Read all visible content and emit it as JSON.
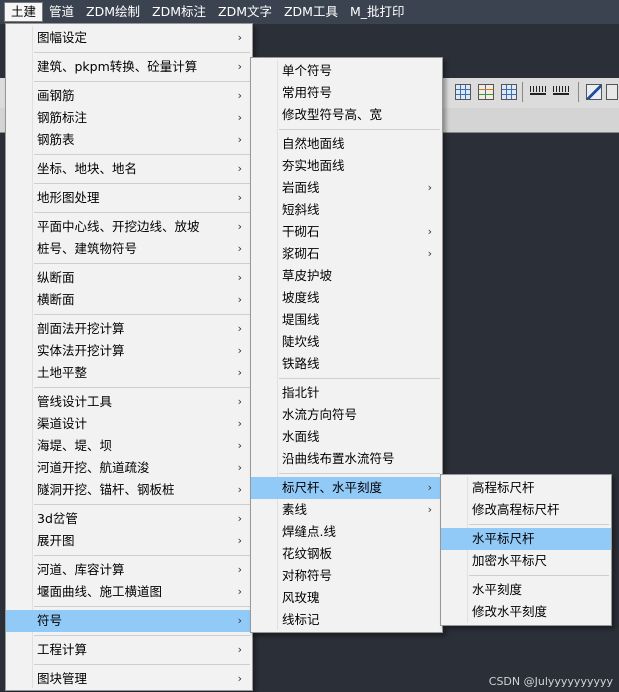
{
  "menubar": {
    "items": [
      "土建",
      "管道",
      "ZDM绘制",
      "ZDM标注",
      "ZDM文字",
      "ZDM工具",
      "M_批打印"
    ]
  },
  "menu1": {
    "groups": [
      [
        {
          "label": "图幅设定",
          "sub": true
        }
      ],
      [
        {
          "label": "建筑、pkpm转换、砼量计算",
          "sub": true
        }
      ],
      [
        {
          "label": "画钢筋",
          "sub": true
        },
        {
          "label": "钢筋标注",
          "sub": true
        },
        {
          "label": "钢筋表",
          "sub": true
        }
      ],
      [
        {
          "label": "坐标、地块、地名",
          "sub": true
        }
      ],
      [
        {
          "label": "地形图处理",
          "sub": true
        }
      ],
      [
        {
          "label": "平面中心线、开挖边线、放坡",
          "sub": true
        },
        {
          "label": "桩号、建筑物符号",
          "sub": true
        }
      ],
      [
        {
          "label": "纵断面",
          "sub": true
        },
        {
          "label": "横断面",
          "sub": true
        }
      ],
      [
        {
          "label": "剖面法开挖计算",
          "sub": true
        },
        {
          "label": "实体法开挖计算",
          "sub": true
        },
        {
          "label": "土地平整",
          "sub": true
        }
      ],
      [
        {
          "label": "管线设计工具",
          "sub": true
        },
        {
          "label": "渠道设计",
          "sub": true
        },
        {
          "label": "海堤、堤、坝",
          "sub": true
        },
        {
          "label": "河道开挖、航道疏浚",
          "sub": true
        },
        {
          "label": "隧洞开挖、锚杆、钢板桩",
          "sub": true
        }
      ],
      [
        {
          "label": "3d岔管",
          "sub": true
        },
        {
          "label": "展开图",
          "sub": true
        }
      ],
      [
        {
          "label": "河道、库容计算",
          "sub": true
        },
        {
          "label": "堰面曲线、施工横道图",
          "sub": true
        }
      ],
      [
        {
          "label": "符号",
          "sub": true,
          "hl": true
        }
      ],
      [
        {
          "label": "工程计算",
          "sub": true
        }
      ],
      [
        {
          "label": "图块管理",
          "sub": true
        }
      ]
    ]
  },
  "menu2": {
    "groups": [
      [
        {
          "label": "单个符号"
        },
        {
          "label": "常用符号"
        },
        {
          "label": "修改型符号高、宽"
        }
      ],
      [
        {
          "label": "自然地面线"
        },
        {
          "label": "夯实地面线"
        },
        {
          "label": "岩面线",
          "sub": true
        },
        {
          "label": "短斜线"
        },
        {
          "label": "干砌石",
          "sub": true
        },
        {
          "label": "浆砌石",
          "sub": true
        },
        {
          "label": "草皮护坡"
        },
        {
          "label": "坡度线"
        },
        {
          "label": "堤围线"
        },
        {
          "label": "陡坎线"
        },
        {
          "label": "铁路线"
        }
      ],
      [
        {
          "label": "指北针"
        },
        {
          "label": "水流方向符号"
        },
        {
          "label": "水面线"
        },
        {
          "label": "沿曲线布置水流符号"
        }
      ],
      [
        {
          "label": "标尺杆、水平刻度",
          "sub": true,
          "hl": true
        },
        {
          "label": "素线",
          "sub": true
        },
        {
          "label": "焊缝点.线"
        },
        {
          "label": "花纹钢板"
        },
        {
          "label": "对称符号"
        },
        {
          "label": "风玫瑰"
        },
        {
          "label": "线标记"
        }
      ]
    ]
  },
  "menu3": {
    "groups": [
      [
        {
          "label": "高程标尺杆"
        },
        {
          "label": "修改高程标尺杆"
        }
      ],
      [
        {
          "label": "水平标尺杆",
          "hl": true
        },
        {
          "label": "加密水平标尺"
        }
      ],
      [
        {
          "label": "水平刻度"
        },
        {
          "label": "修改水平刻度"
        }
      ]
    ]
  },
  "arrow_glyph": "›",
  "watermark": "CSDN @Julyyyyyyyyyy"
}
